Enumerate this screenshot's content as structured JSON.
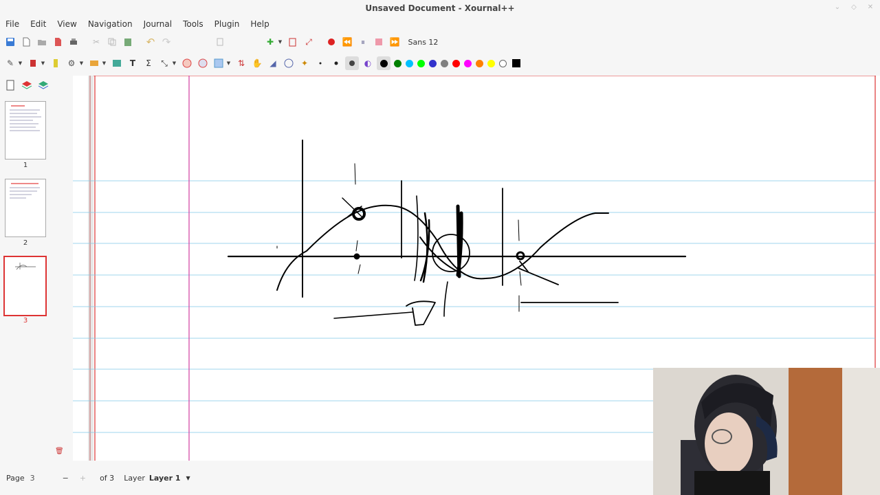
{
  "window": {
    "title": "Unsaved Document - Xournal++"
  },
  "menu": [
    "File",
    "Edit",
    "View",
    "Navigation",
    "Journal",
    "Tools",
    "Plugin",
    "Help"
  ],
  "toolbar": {
    "font_label": "Sans  12"
  },
  "palette": [
    "#000000",
    "#008000",
    "#00c0ff",
    "#00ff00",
    "#3333cc",
    "#808080",
    "#ff0000",
    "#ff00ff",
    "#ff8000",
    "#ffff00",
    "#ffffff"
  ],
  "pages": [
    {
      "num": "1"
    },
    {
      "num": "2"
    },
    {
      "num": "3",
      "active": true
    }
  ],
  "status": {
    "page_label": "Page",
    "page_value": "3",
    "of_label": "of 3",
    "layer_label": "Layer",
    "layer_value": "Layer 1"
  }
}
